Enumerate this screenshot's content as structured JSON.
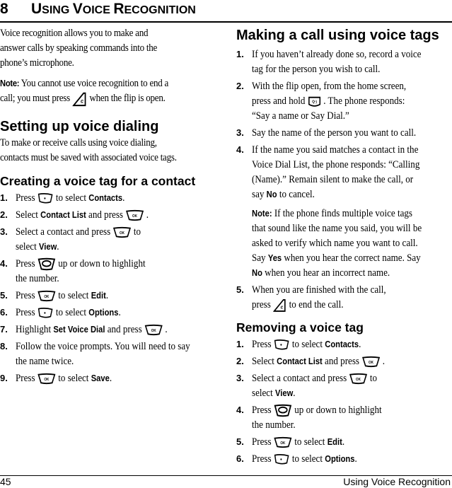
{
  "chapter": {
    "number": "8",
    "title_parts": [
      {
        "text": "U",
        "size": "big"
      },
      {
        "text": "SING ",
        "size": "sm"
      },
      {
        "text": "V",
        "size": "big"
      },
      {
        "text": "OICE ",
        "size": "sm"
      },
      {
        "text": "R",
        "size": "big"
      },
      {
        "text": "ECOGNITION",
        "size": "sm"
      }
    ]
  },
  "intro": {
    "text": "Voice recognition allows you to make and answer calls by speaking commands into the phone’s microphone.",
    "lines": [
      "Voice recognition allows you to make and",
      "answer calls by speaking commands into the",
      "phone’s microphone."
    ]
  },
  "note1": {
    "label": "Note:",
    "line1": " You cannot use voice recognition to end a",
    "line2a": "call; you must press",
    "line2b": "when the flip is open.",
    "icon": "end-key-icon"
  },
  "setup": {
    "heading": "Setting up voice dialing",
    "lines": [
      "To make or receive calls using voice dialing,",
      "contacts must be saved with associated voice tags."
    ]
  },
  "creating": {
    "heading": "Creating a voice tag for a contact",
    "steps": [
      {
        "n": "1.",
        "pre": "Press",
        "icon": "left-softkey-icon",
        "post": "to select",
        "bold": "Contacts",
        "end": "."
      },
      {
        "n": "2.",
        "pre": "Select",
        "bold_pre": "Contact List",
        "mid": "and press",
        "icon": "ok-key-icon",
        "end": "."
      },
      {
        "n": "3.",
        "pre": "Select a contact and press",
        "icon": "ok-key-icon",
        "post": "to",
        "line2": "select",
        "bold": "View",
        "end": "."
      },
      {
        "n": "4.",
        "pre": "Press",
        "icon": "nav-key-icon",
        "post": "up or down to highlight",
        "line2": "the number."
      },
      {
        "n": "5.",
        "pre": "Press",
        "icon": "ok-key-icon",
        "post": "to select",
        "bold": "Edit",
        "end": "."
      },
      {
        "n": "6.",
        "pre": "Press",
        "icon": "left-softkey-icon",
        "post": "to select",
        "bold": "Options",
        "end": "."
      },
      {
        "n": "7.",
        "pre": "Highlight",
        "bold_pre": "Set Voice Dial",
        "mid": "and press",
        "icon": "ok-key-icon",
        "end": "."
      },
      {
        "n": "8.",
        "pre": "Follow the voice prompts. You will need to say",
        "line2": "the name twice."
      },
      {
        "n": "9.",
        "pre": "Press",
        "icon": "ok-key-icon",
        "post": "to select",
        "bold": "Save",
        "end": "."
      }
    ]
  },
  "making": {
    "heading": "Making a call using voice tags",
    "steps": [
      {
        "n": "1.",
        "line1": "If you haven’t already done so, record a voice",
        "line2": "tag for the person you wish to call."
      },
      {
        "n": "2.",
        "line1": "With the flip open, from the home screen,",
        "line2a": "press and hold",
        "icon": "voice-key-icon",
        "line2b": ". The phone responds:",
        "line3": "“Say a name or Say Dial.”"
      },
      {
        "n": "3.",
        "line1": "Say the name of the person you want to call."
      },
      {
        "n": "4.",
        "line1": "If the name you said matches a contact in the",
        "line2": "Voice Dial List, the phone responds: “Calling",
        "line3": "(Name).” Remain silent to make the call, or",
        "line4a": "say",
        "line4bold": "No",
        "line4b": "to cancel."
      },
      {
        "n": "5.",
        "line1": "When you are finished with the call,",
        "line2a": "press",
        "icon": "end-key-icon",
        "line2b": "to end the call."
      }
    ],
    "note": {
      "label": "Note:",
      "line1": " If the phone finds multiple voice tags",
      "line2": "that sound like the name you said, you will be",
      "line3": "asked to verify which name you want to call.",
      "line4a": "Say",
      "line4bold": "Yes",
      "line4b": "when you hear the correct name. Say",
      "line5bold": "No",
      "line5b": "when you hear an incorrect name."
    }
  },
  "removing": {
    "heading": "Removing a voice tag",
    "steps": [
      {
        "n": "1.",
        "pre": "Press",
        "icon": "left-softkey-icon",
        "post": "to select",
        "bold": "Contacts",
        "end": "."
      },
      {
        "n": "2.",
        "pre": "Select",
        "bold_pre": "Contact List",
        "mid": "and press",
        "icon": "ok-key-icon",
        "end": "."
      },
      {
        "n": "3.",
        "pre": "Select a contact and press",
        "icon": "ok-key-icon",
        "post": "to",
        "line2": "select",
        "bold": "View",
        "end": "."
      },
      {
        "n": "4.",
        "pre": "Press",
        "icon": "nav-key-icon",
        "post": "up or down to highlight",
        "line2": "the number."
      },
      {
        "n": "5.",
        "pre": "Press",
        "icon": "ok-key-icon",
        "post": "to select",
        "bold": "Edit",
        "end": "."
      },
      {
        "n": "6.",
        "pre": "Press",
        "icon": "left-softkey-icon",
        "post": "to select",
        "bold": "Options",
        "end": "."
      }
    ]
  },
  "footer": {
    "page_number": "45",
    "section": "Using Voice Recognition"
  }
}
